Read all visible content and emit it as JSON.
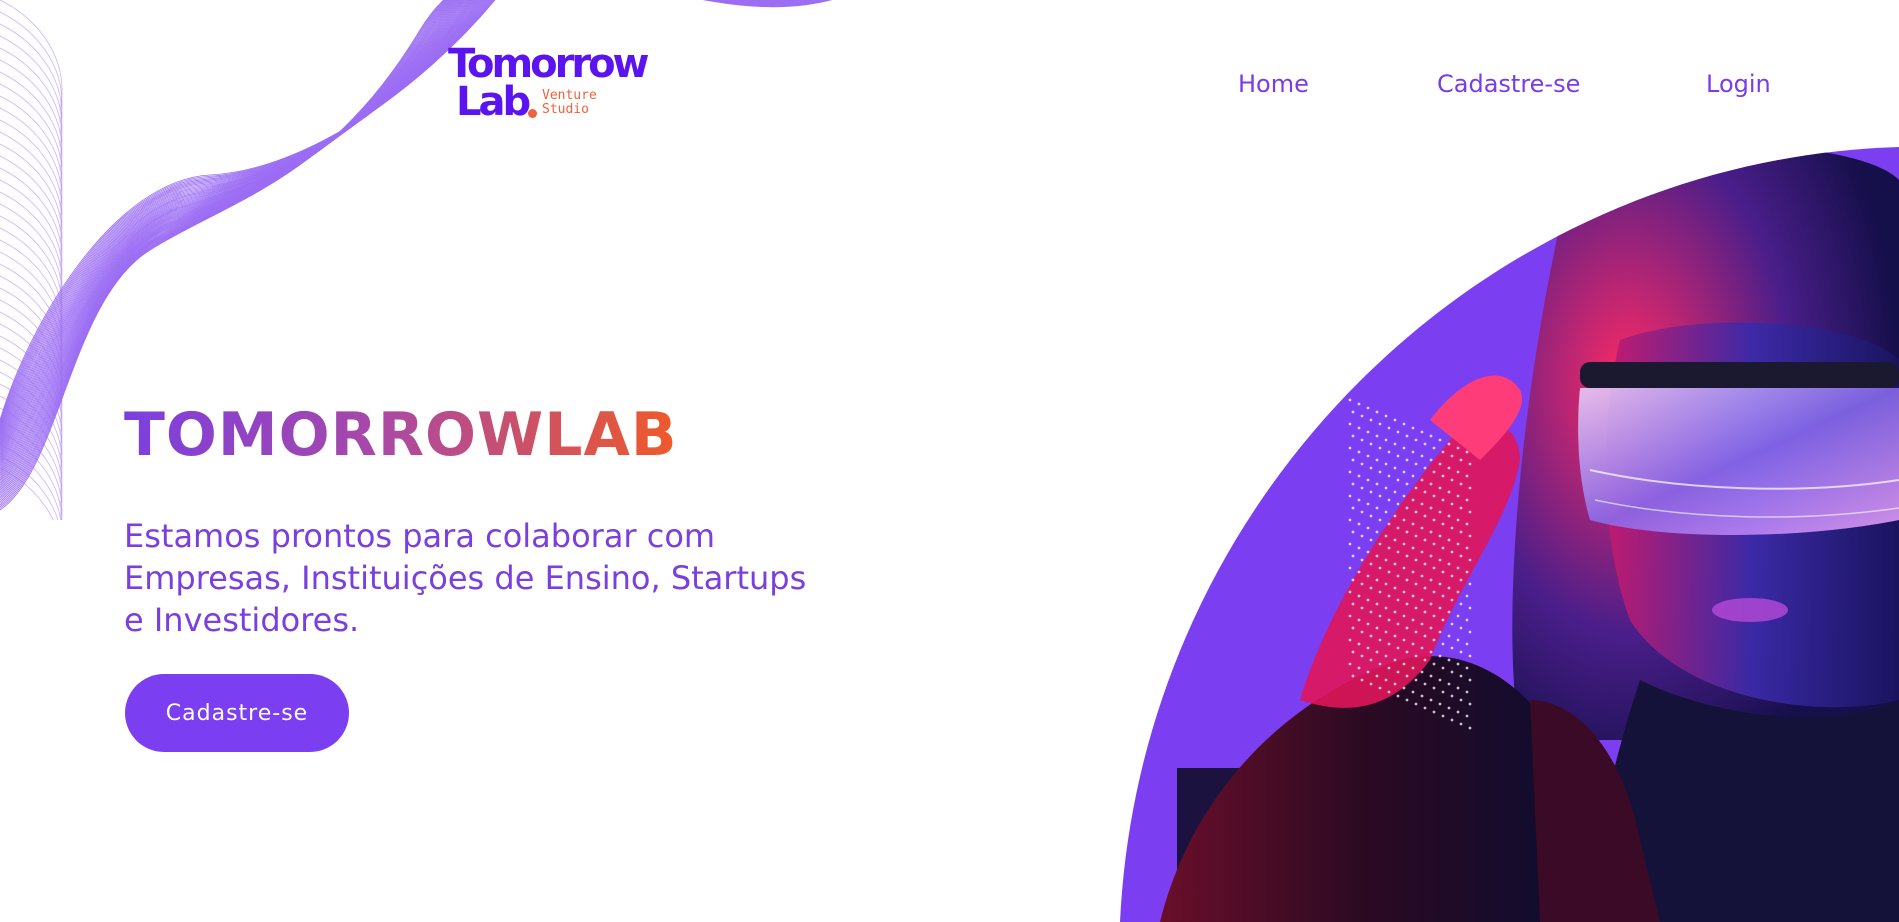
{
  "logo": {
    "word_top": "Tomorrow",
    "word_bottom": "Lab",
    "sub_line1": "Venture",
    "sub_line2": "Studio"
  },
  "nav": {
    "home": "Home",
    "cadastre": "Cadastre-se",
    "login": "Login"
  },
  "hero": {
    "title": "TOMORROWLAB",
    "subtitle_lines": [
      "Estamos prontos para colaborar com",
      "Empresas, Instituições de Ensino, Startups",
      "e Investidores."
    ],
    "cta_label": "Cadastre-se"
  },
  "colors": {
    "brand_purple": "#7b3ef0",
    "logo_purple": "#5b14f0",
    "accent_orange": "#f0623a",
    "title_gradient_start": "#7b3fe0",
    "title_gradient_end": "#f05a28",
    "background": "#ffffff"
  },
  "icons": {
    "wave_decoration": "wave-lines-decoration",
    "hero_photo": "woman-vr-visor-photo"
  }
}
